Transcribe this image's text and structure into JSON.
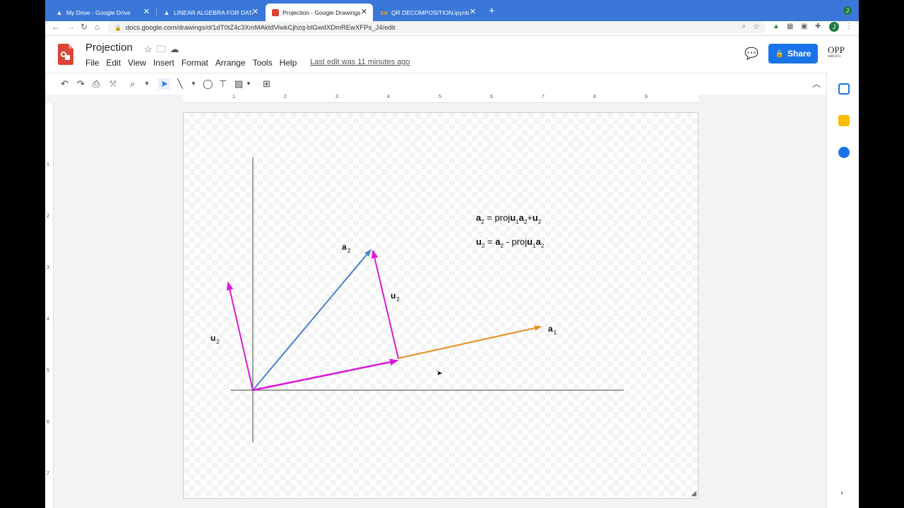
{
  "browser": {
    "tabs": [
      {
        "title": "My Drive - Google Drive",
        "icon": "google-drive-icon"
      },
      {
        "title": "LINEAR ALGEBRA FOR DATA S",
        "icon": "google-drive-icon"
      },
      {
        "title": "Projection - Google Drawings",
        "icon": "google-drawings-icon",
        "active": true
      },
      {
        "title": "QR DECOMPOSITION.ipynb - C",
        "icon": "colab-icon"
      }
    ],
    "url": "docs.google.com/drawings/d/1dT0tZ4c3XmMAktdViwkCjhzq-blGwdXDmREwXFPs_J4/edit",
    "profile_initial": "J"
  },
  "app": {
    "title": "Projection",
    "menus": [
      "File",
      "Edit",
      "View",
      "Insert",
      "Format",
      "Arrange",
      "Tools",
      "Help"
    ],
    "last_edit": "Last edit was 11 minutes ago",
    "share_label": "Share",
    "account_logo": "OPP",
    "account_logo_small": "ARCH G"
  },
  "ruler": {
    "horizontal": [
      "1",
      "2",
      "3",
      "4",
      "5",
      "6",
      "7",
      "8",
      "9"
    ],
    "vertical": [
      "1",
      "2",
      "3",
      "4",
      "5",
      "6",
      "7"
    ]
  },
  "drawing": {
    "labels": {
      "a2": {
        "main": "a",
        "sub": "2"
      },
      "u2_middle": {
        "main": "u",
        "sub": "2"
      },
      "u2_left": {
        "main": "u",
        "sub": "2"
      },
      "a1": {
        "main": "a",
        "sub": "1"
      }
    },
    "equations": [
      "a2 = proju1a2+u2",
      "u2 = a2 - proju1a2"
    ],
    "colors": {
      "a1": "#e8901e",
      "a2": "#4a7fd0",
      "u2": "#d81bd8",
      "proj": "#d81bd8",
      "axes": "#444444"
    }
  }
}
